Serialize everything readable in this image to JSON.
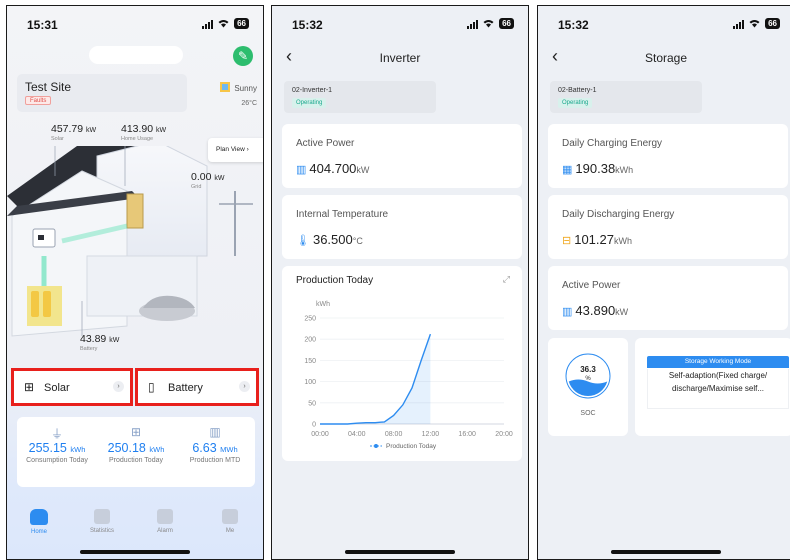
{
  "status": {
    "time1": "15:31",
    "time2": "15:32",
    "time3": "15:32",
    "battery": "66"
  },
  "home": {
    "site_name": "Test Site",
    "site_badge": "Faults",
    "weather": {
      "condition": "Sunny",
      "temp": "26°C"
    },
    "solar": {
      "value": "457.79",
      "unit": "kW",
      "label": "Solar"
    },
    "home_usage": {
      "value": "413.90",
      "unit": "kW",
      "label": "Home Usage"
    },
    "grid": {
      "value": "0.00",
      "unit": "kW",
      "label": "Grid"
    },
    "battery": {
      "value": "43.89",
      "unit": "kW",
      "label": "Battery"
    },
    "plan_view": "Plan View",
    "quick_solar": "Solar",
    "quick_battery": "Battery",
    "energy": [
      {
        "value": "255.15",
        "unit": "kWh",
        "label": "Consumption Today"
      },
      {
        "value": "250.18",
        "unit": "kWh",
        "label": "Production Today"
      },
      {
        "value": "6.63",
        "unit": "MWh",
        "label": "Production MTD"
      }
    ],
    "tabs": [
      "Home",
      "Statistics",
      "Alarm",
      "Me"
    ],
    "active_tab": "Home"
  },
  "inverter": {
    "title": "Inverter",
    "device_name": "02-Inverter-1",
    "device_status": "Operating",
    "active_power": {
      "label": "Active Power",
      "value": "404.700",
      "unit": "kW"
    },
    "temperature": {
      "label": "Internal Temperature",
      "value": "36.500",
      "unit": "°C"
    },
    "chart_title": "Production Today"
  },
  "chart_data": {
    "type": "line",
    "title": "Production Today",
    "ylabel": "kWh",
    "x": [
      "00:00",
      "04:00",
      "08:00",
      "12:00",
      "16:00",
      "20:00"
    ],
    "ylim": [
      0,
      250
    ],
    "yticks": [
      0,
      50,
      100,
      150,
      200,
      250
    ],
    "series": [
      {
        "name": "Production Today",
        "points": [
          [
            0,
            0
          ],
          [
            1,
            0
          ],
          [
            2,
            0
          ],
          [
            3,
            0
          ],
          [
            4,
            2
          ],
          [
            5,
            3
          ],
          [
            6,
            3
          ],
          [
            7,
            5
          ],
          [
            8,
            20
          ],
          [
            9,
            45
          ],
          [
            10,
            85
          ],
          [
            11,
            150
          ],
          [
            12,
            212
          ]
        ]
      }
    ],
    "legend": "bottom",
    "color": "#2d8cf0"
  },
  "storage": {
    "title": "Storage",
    "device_name": "02-Battery-1",
    "device_status": "Operating",
    "charging": {
      "label": "Daily Charging Energy",
      "value": "190.38",
      "unit": "kWh"
    },
    "discharging": {
      "label": "Daily Discharging Energy",
      "value": "101.27",
      "unit": "kWh"
    },
    "active_power": {
      "label": "Active Power",
      "value": "43.890",
      "unit": "kW"
    },
    "soc": {
      "value": 36.3,
      "display": "36.3",
      "unit": "%",
      "label": "SOC"
    },
    "mode_title": "Storage Working Mode",
    "mode_value": "Self-adaption(Fixed charge/ discharge/Maximise self..."
  }
}
